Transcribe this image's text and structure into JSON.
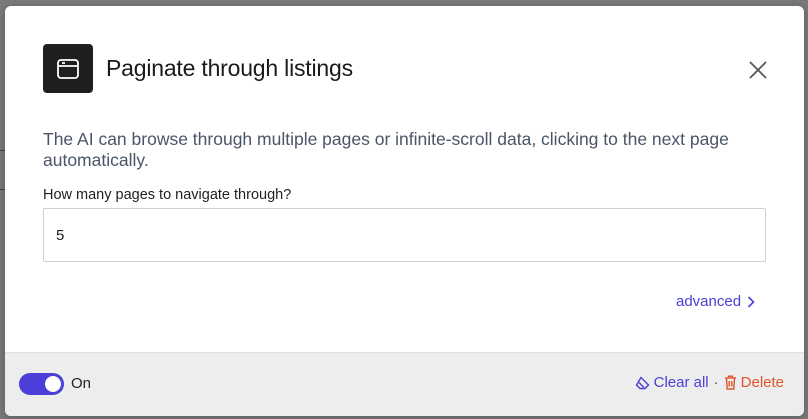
{
  "dialog": {
    "title": "Paginate through listings",
    "header_icon": "browser-window-icon",
    "close_icon": "close-icon",
    "description": "The AI can browse through multiple pages or infinite-scroll data, clicking to the next page automatically.",
    "pages_field": {
      "label": "How many pages to navigate through?",
      "value": "5"
    },
    "advanced": {
      "label": "advanced",
      "icon": "chevron-right-icon"
    }
  },
  "footer": {
    "toggle": {
      "state": "on",
      "label": "On",
      "color": "#4b3fd9"
    },
    "clear_all": {
      "label": "Clear all",
      "icon": "eraser-icon",
      "color": "#4a3fd6"
    },
    "separator": "·",
    "delete": {
      "label": "Delete",
      "icon": "trash-icon",
      "color": "#e0552b"
    }
  }
}
